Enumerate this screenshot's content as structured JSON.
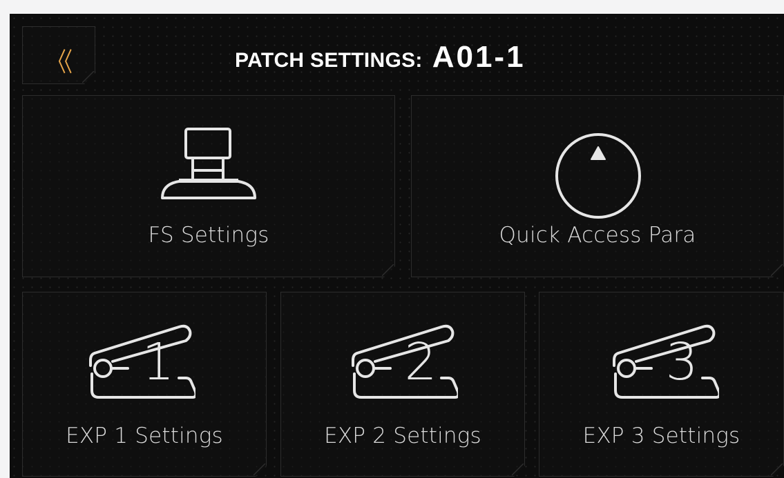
{
  "header": {
    "back_glyph": "〈〈",
    "title_label": "PATCH SETTINGS:",
    "patch_id": "A01-1"
  },
  "cards": {
    "fs_settings": {
      "label": "FS Settings",
      "icon": "footswitch-icon"
    },
    "quick_access": {
      "label": "Quick Access Para",
      "icon": "knob-icon"
    },
    "exp1": {
      "label": "EXP 1 Settings",
      "icon": "expression-pedal-icon",
      "number": "1"
    },
    "exp2": {
      "label": "EXP 2 Settings",
      "icon": "expression-pedal-icon",
      "number": "2"
    },
    "exp3": {
      "label": "EXP 3 Settings",
      "icon": "expression-pedal-icon",
      "number": "3"
    }
  },
  "colors": {
    "background": "#0d0d0d",
    "accent": "#e8a64a",
    "text": "#dcdcdc",
    "border": "#2d2d2d"
  }
}
